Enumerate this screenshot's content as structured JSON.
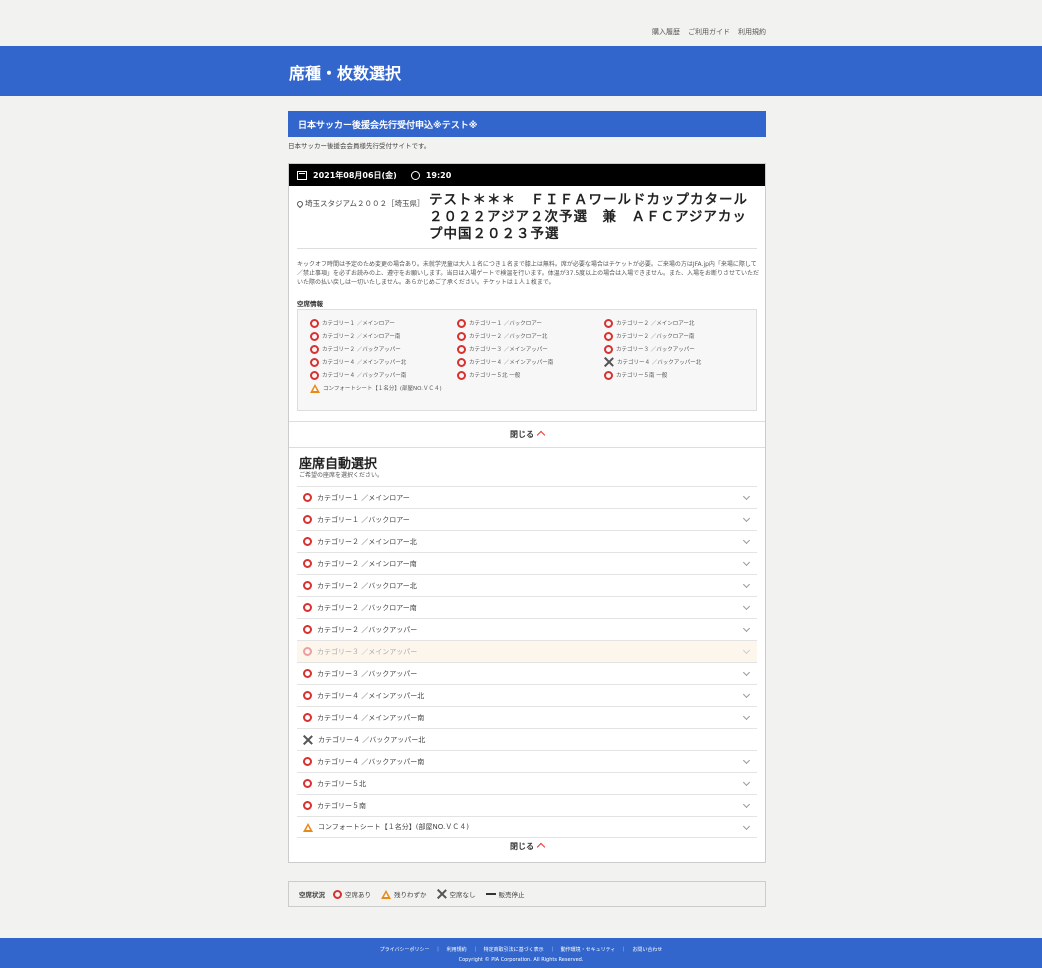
{
  "header": {
    "links": [
      "購入履歴",
      "ご利用ガイド",
      "利用規約"
    ],
    "page_title": "席種・枚数選択"
  },
  "event": {
    "name": "日本サッカー後援会先行受付申込※テスト※",
    "subtitle": "日本サッカー後援会会員様先行受付サイトです。",
    "date": "2021年08月06日(金)",
    "time": "19:20",
    "venue": "埼玉スタジアム２００２［埼玉県］",
    "title": "テスト＊＊＊　ＦＩＦＡワールドカップカタール２０２２アジア２次予選　兼　ＡＦＣアジアカップ中国２０２３予選",
    "notes": "キックオフ時間は予定のため変更の場合あり。未就学児童は大人１名につき１名まで膝上は無料。席が必要な場合はチケットが必要。ご来場の方はJFA.jp内「来場に際して／禁止事項」を必ずお読みの上、遵守をお願いします。当日は入場ゲートで検温を行います。体温が37.5度以上の場合は入場できません。また、入場をお断りさせていただいた際の払い戻しは一切いたしません。あらかじめご了承ください。チケットは１人１枚まで。",
    "seat_info_label": "空席情報"
  },
  "seat_info": [
    {
      "status": "circle",
      "label": "カテゴリー１ ／メインロアー"
    },
    {
      "status": "circle",
      "label": "カテゴリー１ ／バックロアー"
    },
    {
      "status": "circle",
      "label": "カテゴリー２ ／メインロアー北"
    },
    {
      "status": "circle",
      "label": "カテゴリー２ ／メインロアー南"
    },
    {
      "status": "circle",
      "label": "カテゴリー２ ／バックロアー北"
    },
    {
      "status": "circle",
      "label": "カテゴリー２ ／バックロアー南"
    },
    {
      "status": "circle",
      "label": "カテゴリー２ ／バックアッパー"
    },
    {
      "status": "circle",
      "label": "カテゴリー３ ／メインアッパー"
    },
    {
      "status": "circle",
      "label": "カテゴリー３ ／バックアッパー"
    },
    {
      "status": "circle",
      "label": "カテゴリー４ ／メインアッパー北"
    },
    {
      "status": "circle",
      "label": "カテゴリー４ ／メインアッパー南"
    },
    {
      "status": "cross",
      "label": "カテゴリー４ ／バックアッパー北"
    },
    {
      "status": "circle",
      "label": "カテゴリー４ ／バックアッパー南"
    },
    {
      "status": "circle",
      "label": "カテゴリー５北 一般"
    },
    {
      "status": "circle",
      "label": "カテゴリー５南 一般"
    },
    {
      "status": "triangle",
      "label": "コンフォートシート【１名分】(部屋NO.ＶＣ４)"
    }
  ],
  "close_label": "閉じる",
  "auto_select": {
    "title": "座席自動選択",
    "subtitle": "ご希望の座席を選択ください。",
    "rows": [
      {
        "status": "circle",
        "label": "カテゴリー１ ／メインロアー"
      },
      {
        "status": "circle",
        "label": "カテゴリー１ ／バックロアー"
      },
      {
        "status": "circle",
        "label": "カテゴリー２ ／メインロアー北"
      },
      {
        "status": "circle",
        "label": "カテゴリー２ ／メインロアー南"
      },
      {
        "status": "circle",
        "label": "カテゴリー２ ／バックロアー北"
      },
      {
        "status": "circle",
        "label": "カテゴリー２ ／バックロアー南"
      },
      {
        "status": "circle",
        "label": "カテゴリー２ ／バックアッパー"
      },
      {
        "status": "circle",
        "label": "カテゴリー３ ／メインアッパー",
        "highlighted": true
      },
      {
        "status": "circle",
        "label": "カテゴリー３ ／バックアッパー"
      },
      {
        "status": "circle",
        "label": "カテゴリー４ ／メインアッパー北"
      },
      {
        "status": "circle",
        "label": "カテゴリー４ ／メインアッパー南"
      },
      {
        "status": "cross",
        "label": "カテゴリー４ ／バックアッパー北",
        "no_chevron": true
      },
      {
        "status": "circle",
        "label": "カテゴリー４ ／バックアッパー南"
      },
      {
        "status": "circle",
        "label": "カテゴリー５北"
      },
      {
        "status": "circle",
        "label": "カテゴリー５南"
      },
      {
        "status": "triangle",
        "label": "コンフォートシート【１名分】(部屋NO.ＶＣ４)"
      }
    ]
  },
  "legend": {
    "label": "空席状況",
    "items": [
      {
        "status": "circle",
        "label": "空席あり"
      },
      {
        "status": "triangle",
        "label": "残りわずか"
      },
      {
        "status": "cross",
        "label": "空席なし"
      },
      {
        "status": "dash",
        "label": "販売停止"
      }
    ]
  },
  "footer": {
    "links": [
      "プライバシーポリシー",
      "｜",
      "利用規約",
      "｜",
      "特定商取引法に基づく表示",
      "｜",
      "動作環境・セキュリティ",
      "｜",
      "お問い合わせ"
    ],
    "copyright": "Copyright © PIA Corporation. All Rights Reserved."
  },
  "colors": {
    "brand_blue": "#3366cc",
    "available_red": "#d93030",
    "few_orange": "#e88a1a"
  }
}
